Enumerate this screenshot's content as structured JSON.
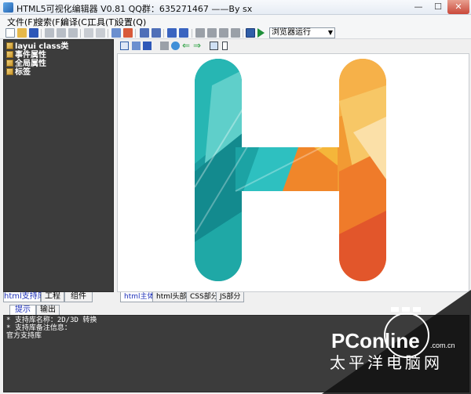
{
  "window": {
    "title": "HTML5可视化编辑器 V0.81 QQ群：635271467 ——By sx",
    "min": "—",
    "max": "☐",
    "close": "✕"
  },
  "menu": [
    "文件(F)",
    "搜索(F)",
    "编译(C)",
    "工具(T)",
    "设置(Q)"
  ],
  "toolbar": {
    "icons": [
      "new-file-icon",
      "open-folder-icon",
      "save-icon",
      "cut-icon",
      "copy-icon",
      "paste-icon",
      "undo-icon",
      "redo-icon",
      "preview-icon",
      "list-icon",
      "format-icon",
      "replace-icon",
      "indent-icon",
      "outdent-icon",
      "tag-icon",
      "tag-up-icon",
      "tag-down-icon",
      "tag-remove-icon",
      "browser-icon",
      "run-icon"
    ],
    "run_select": "浏览器运行"
  },
  "tree": {
    "items": [
      {
        "label": "layui class类"
      },
      {
        "label": "事件属性"
      },
      {
        "label": "全局属性"
      },
      {
        "label": "标签"
      }
    ]
  },
  "left_tabs": [
    "html支持库",
    "工程",
    "组件"
  ],
  "editor_tabs": [
    "html主体",
    "html头部",
    "CSS部分",
    "JS部分"
  ],
  "output": {
    "tabs": [
      "提示",
      "输出"
    ],
    "lines": [
      "* 支持库名称：2D/3D 转换",
      "* 支持库备注信息：",
      "官方支持库"
    ]
  },
  "watermark": {
    "brand": "PConline",
    "domain": ".com.cn",
    "tagline": "太平洋电脑网"
  },
  "colors": {
    "accent": "#1c2fb8",
    "panel_dark": "#3c3c3c",
    "teal": "#19a3a5",
    "orange": "#f0862a"
  }
}
